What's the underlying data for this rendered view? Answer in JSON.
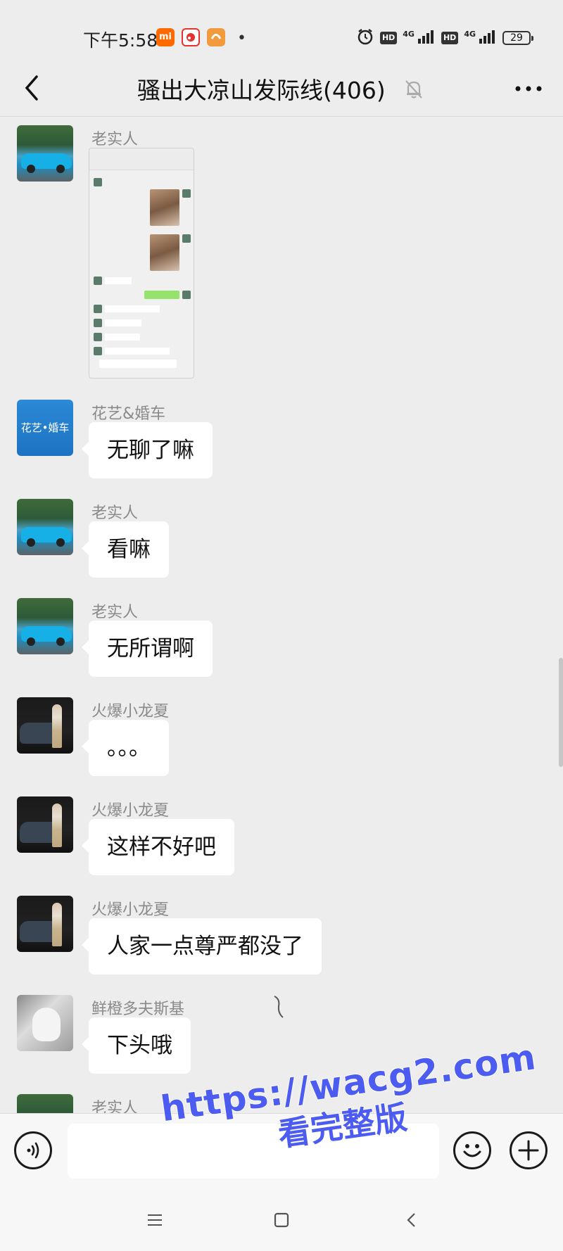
{
  "status_bar": {
    "time": "下午5:58",
    "apps": [
      {
        "name": "mi-icon",
        "label": "mi",
        "color": "#ff6900"
      },
      {
        "name": "weibo-icon",
        "label": "",
        "color": "#ffffff"
      },
      {
        "name": "uc-browser-icon",
        "label": "",
        "color": "#f19a3e"
      }
    ],
    "dot": "•",
    "network": [
      "4G",
      "4G"
    ],
    "hd": [
      "HD",
      "HD"
    ],
    "battery": "29"
  },
  "header": {
    "title": "骚出大凉山发际线(406)"
  },
  "messages": [
    {
      "sender": "老实人",
      "type": "image",
      "avatar": "car"
    },
    {
      "sender": "花艺&婚车",
      "text": "无聊了嘛",
      "avatar": "flower",
      "avatar_text": "花艺•婚车"
    },
    {
      "sender": "老实人",
      "text": "看嘛",
      "avatar": "car"
    },
    {
      "sender": "老实人",
      "text": "无所谓啊",
      "avatar": "car"
    },
    {
      "sender": "火爆小龙夏",
      "text": "。。。",
      "avatar": "fire"
    },
    {
      "sender": "火爆小龙夏",
      "text": "这样不好吧",
      "avatar": "fire"
    },
    {
      "sender": "火爆小龙夏",
      "text": "人家一点尊严都没了",
      "avatar": "fire"
    },
    {
      "sender": "鲜橙多夫斯基",
      "text": "下头哦",
      "avatar": "orange"
    },
    {
      "sender": "老实人",
      "avatar": "car"
    }
  ],
  "watermark": {
    "url": "https://wacg2.com",
    "subtitle": "看完整版"
  },
  "colors": {
    "background": "#ededed",
    "bubble": "#ffffff",
    "watermark": "#4d5cf0"
  }
}
